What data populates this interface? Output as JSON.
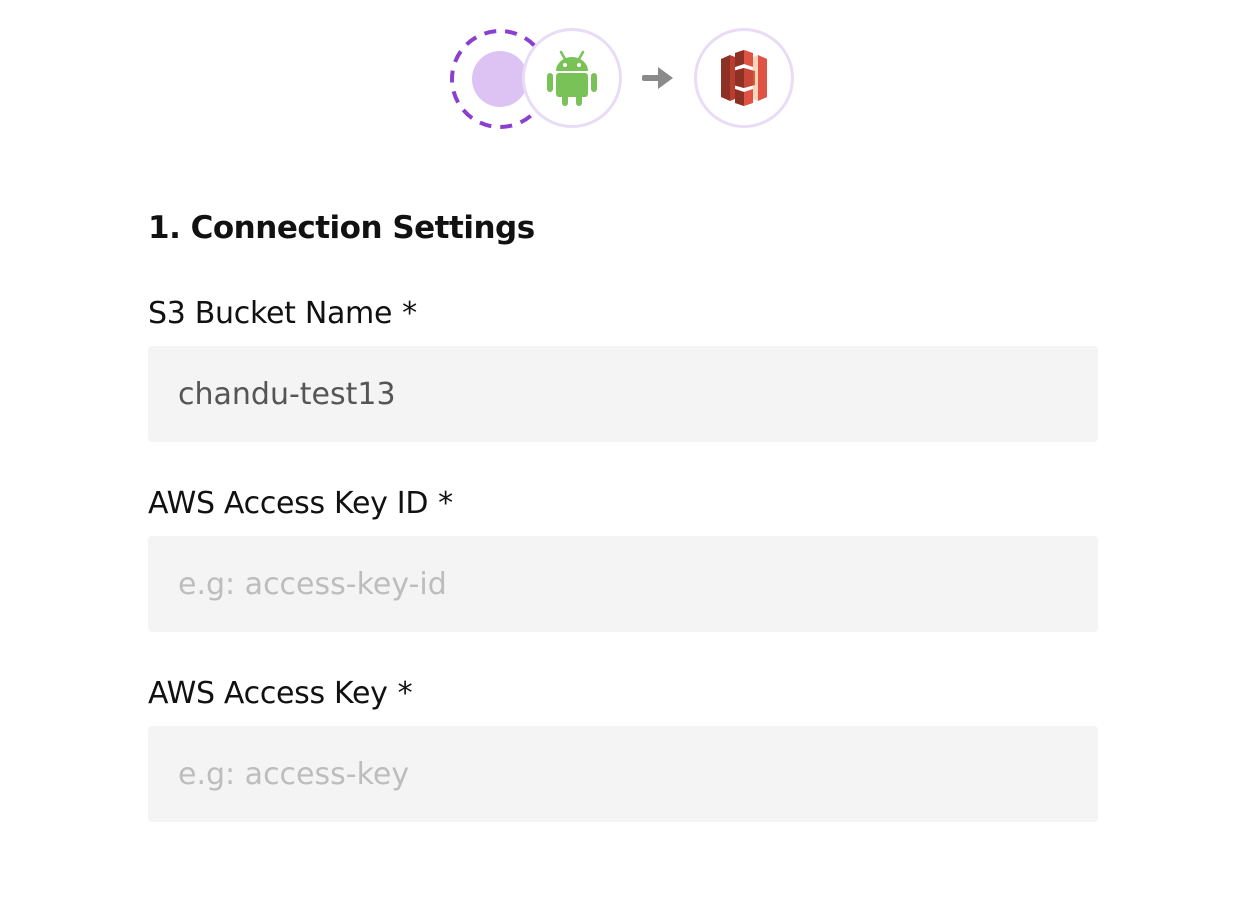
{
  "header": {
    "source_icon": "source-placeholder-icon",
    "android_icon": "android-icon",
    "arrow_icon": "arrow-right-icon",
    "destination_icon": "amazon-s3-icon",
    "colors": {
      "accent_purple": "#8a3fd1",
      "placeholder_fill": "#dcc3f3",
      "ring": "#e9dcf7",
      "android_green": "#78c257",
      "s3_red": "#c7473a",
      "arrow_gray": "#8a8a8a"
    }
  },
  "section": {
    "title": "1. Connection Settings"
  },
  "fields": {
    "bucket": {
      "label": "S3 Bucket Name",
      "required_mark": "*",
      "value": "chandu-test13",
      "placeholder": ""
    },
    "access_key_id": {
      "label": "AWS Access Key ID",
      "required_mark": "*",
      "value": "",
      "placeholder": "e.g: access-key-id"
    },
    "access_key": {
      "label": "AWS Access Key",
      "required_mark": "*",
      "value": "",
      "placeholder": "e.g: access-key"
    }
  }
}
